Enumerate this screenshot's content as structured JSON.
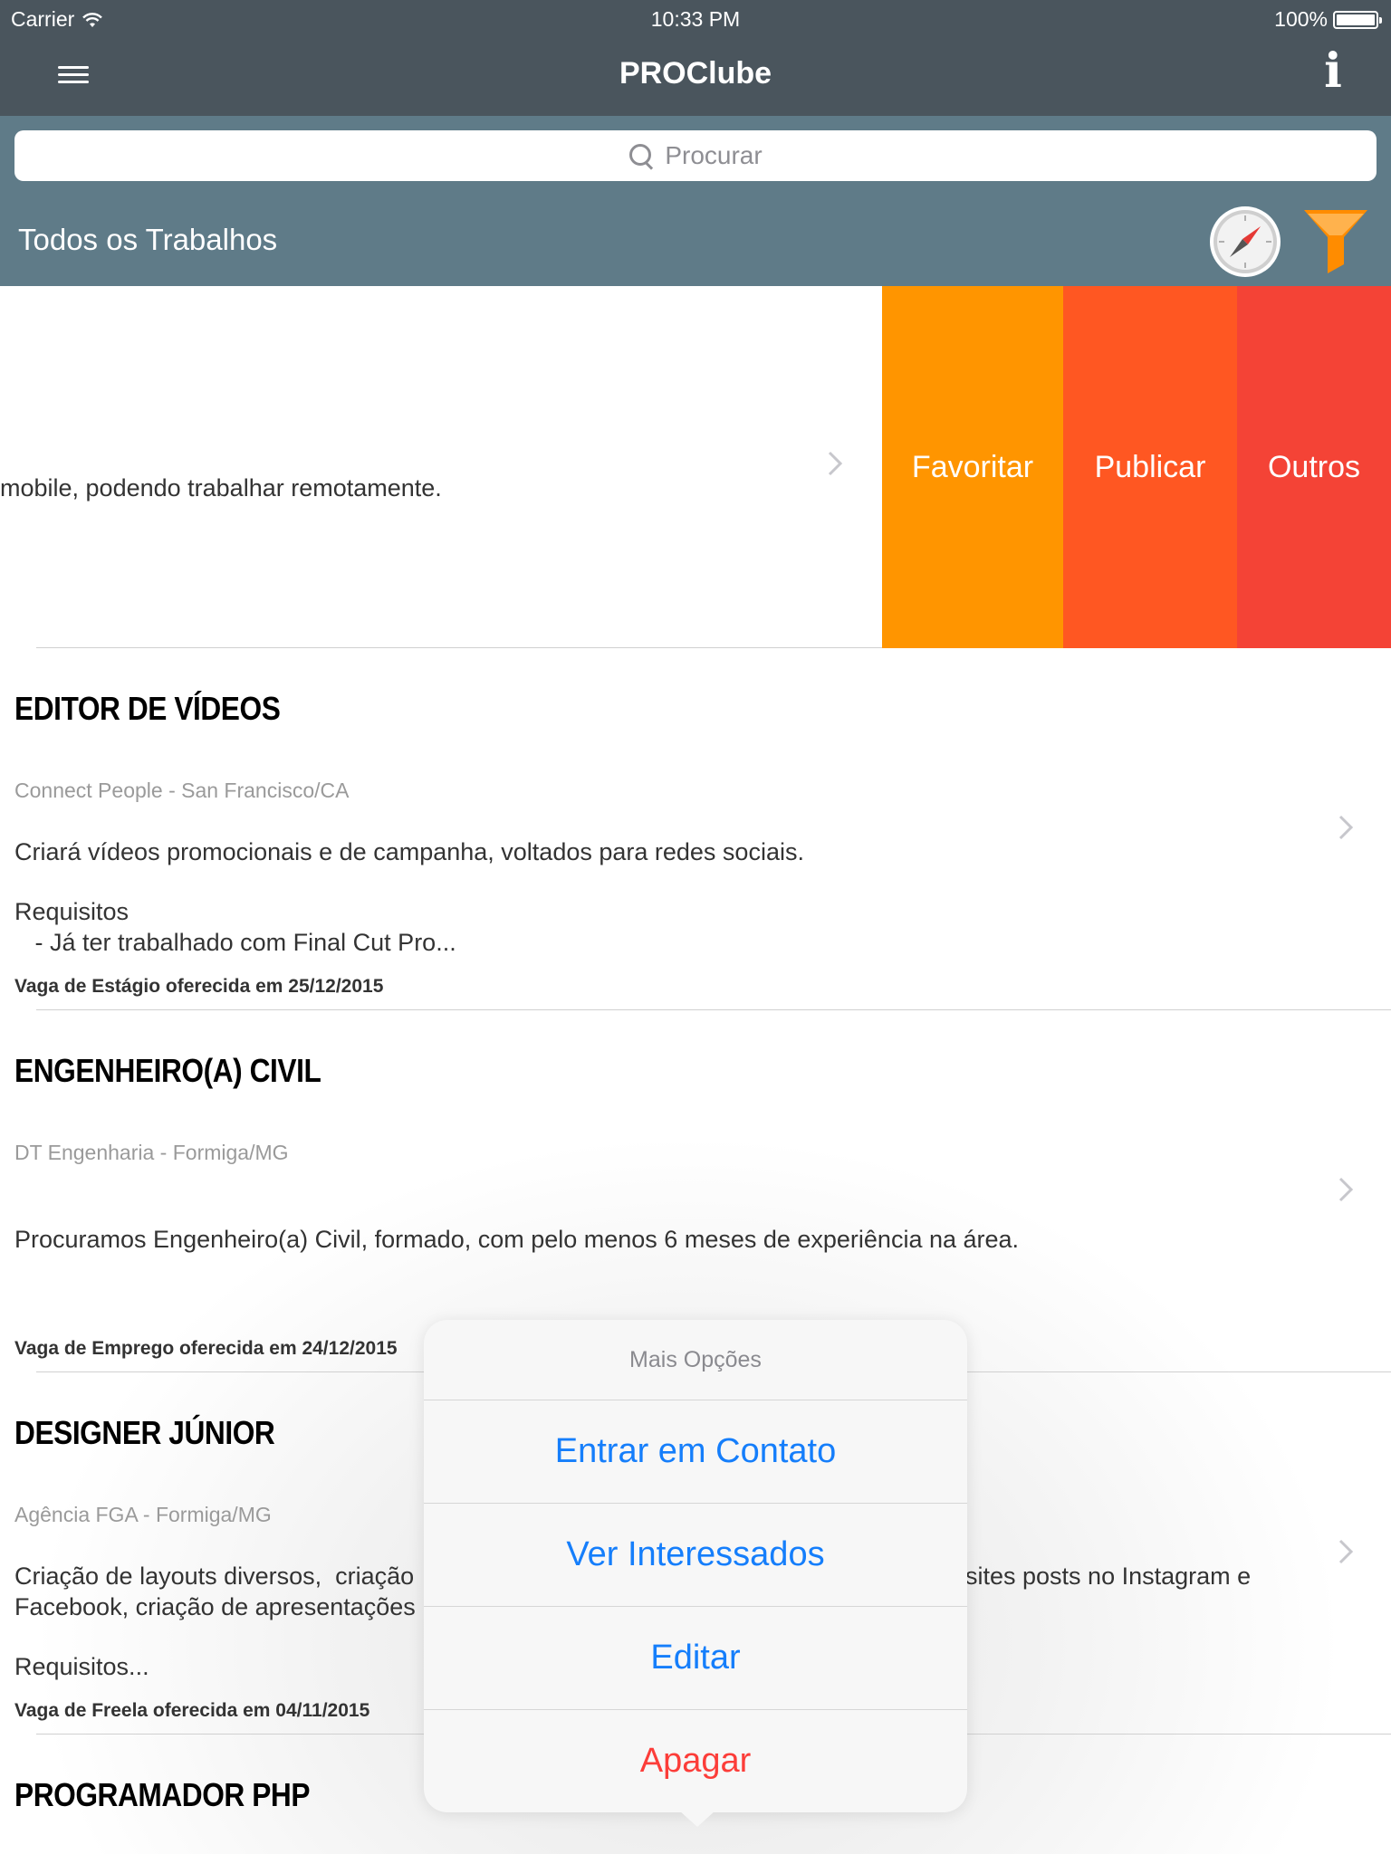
{
  "status_bar": {
    "carrier": "Carrier",
    "time": "10:33 PM",
    "battery": "100%"
  },
  "nav": {
    "title": "PROClube"
  },
  "search": {
    "placeholder": "Procurar"
  },
  "section": {
    "title": "Todos os Trabalhos"
  },
  "swiped_row": {
    "description": "mobile, podendo trabalhar remotamente.",
    "actions": [
      "Favoritar",
      "Publicar",
      "Outros"
    ]
  },
  "jobs": [
    {
      "title": "EDITOR DE VÍDEOS",
      "company": "Connect People - San Francisco/CA",
      "line1": "Criará vídeos promocionais e de campanha, voltados para redes sociais.",
      "line2": "Requisitos",
      "line3": "   - Já ter trabalhado com Final Cut Pro...",
      "footer": "Vaga de Estágio oferecida em 25/12/2015"
    },
    {
      "title": "ENGENHEIRO(A) CIVIL",
      "company": "DT Engenharia - Formiga/MG",
      "line1": "Procuramos Engenheiro(a) Civil, formado, com pelo menos 6 meses de experiência na área.",
      "footer": "Vaga de Emprego oferecida em 24/12/2015"
    },
    {
      "title": "DESIGNER JÚNIOR",
      "company": "Agência FGA - Formiga/MG",
      "line1": "Criação de layouts diversos,  criação",
      "line1_right": "sites posts no Instagram e",
      "line2": "Facebook, criação de apresentações",
      "line3": "Requisitos...",
      "footer": "Vaga de Freela oferecida em 04/11/2015"
    },
    {
      "title": "PROGRAMADOR PHP"
    }
  ],
  "action_sheet": {
    "title": "Mais Opções",
    "options": [
      "Entrar em Contato",
      "Ver Interessados",
      "Editar",
      "Apagar"
    ]
  },
  "colors": {
    "nav_bg": "#4a555d",
    "header_bg": "#5f7b88",
    "favoritar": "#ff9500",
    "publicar": "#ff5722",
    "outros": "#f44336",
    "link_blue": "#157efb",
    "destructive_red": "#fc3d39",
    "filter_orange": "#ff8c00"
  },
  "icons": [
    "menu-icon",
    "info-icon",
    "search-icon",
    "compass-icon",
    "filter-icon",
    "chevron-right-icon",
    "wifi-icon",
    "battery-icon"
  ]
}
